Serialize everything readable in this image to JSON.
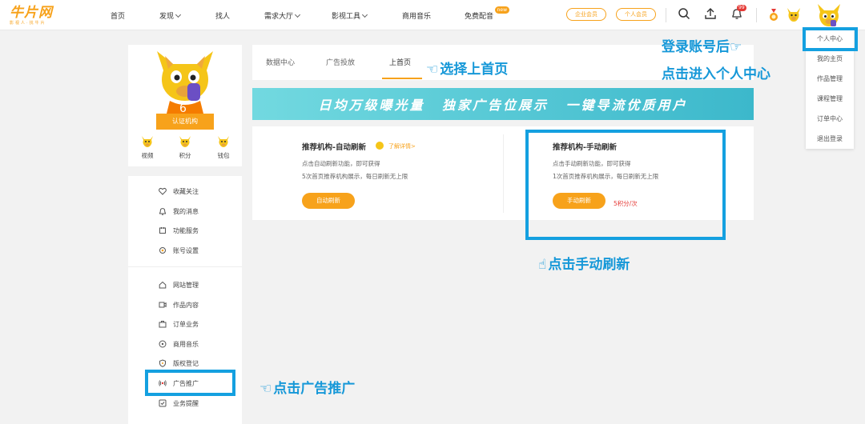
{
  "logo": {
    "main": "牛片网",
    "sub": "影视人·找牛片"
  },
  "nav": {
    "items": [
      {
        "label": "首页",
        "has_chevron": false
      },
      {
        "label": "发现",
        "has_chevron": true
      },
      {
        "label": "找人",
        "has_chevron": false
      },
      {
        "label": "需求大厅",
        "has_chevron": true
      },
      {
        "label": "影视工具",
        "has_chevron": true
      },
      {
        "label": "商用音乐",
        "has_chevron": false
      },
      {
        "label": "免费配音",
        "has_chevron": false
      }
    ],
    "new_badge": "new",
    "enterprise_member": "企业会员",
    "personal_member": "个人会员",
    "notification_count": "99"
  },
  "dropdown": {
    "items": [
      "个人中心",
      "我的主页",
      "作品管理",
      "课程管理",
      "订单中心",
      "退出登录"
    ]
  },
  "profile": {
    "cert_button": "认证机构",
    "stats": [
      "视频",
      "积分",
      "钱包"
    ]
  },
  "side_menu": {
    "group1": [
      "收藏关注",
      "我的消息",
      "功能服务",
      "账号设置"
    ],
    "group2": [
      "网站管理",
      "作品内容",
      "订单业务",
      "商用音乐",
      "版权登记",
      "广告推广",
      "业务提醒"
    ]
  },
  "tabs": [
    "数据中心",
    "广告投放",
    "上首页"
  ],
  "banner": "日均万级曝光量 独家广告位展示 一键导流优质用户",
  "auto_refresh": {
    "title": "推荐机构-自动刷新",
    "detail_link": "了解详情>",
    "desc1": "点击自动刷新功能，即可获得",
    "desc2": "5次首页推荐机构展示，每日刷新无上限",
    "button": "自动刷新"
  },
  "manual_refresh": {
    "title": "推荐机构-手动刷新",
    "desc1": "点击手动刷新功能，即可获得",
    "desc2": "1次首页推荐机构展示，每日刷新无上限",
    "button": "手动刷新",
    "points": "5积分/次"
  },
  "annotations": {
    "select_home": "选择上首页",
    "login_after": "登录账号后",
    "enter_center": "点击进入个人中心",
    "click_manual": "点击手动刷新",
    "click_ad": "点击广告推广"
  },
  "colors": {
    "accent": "#f7a21b",
    "annotation": "#14a0e0",
    "banner": "#4cc2d2"
  }
}
